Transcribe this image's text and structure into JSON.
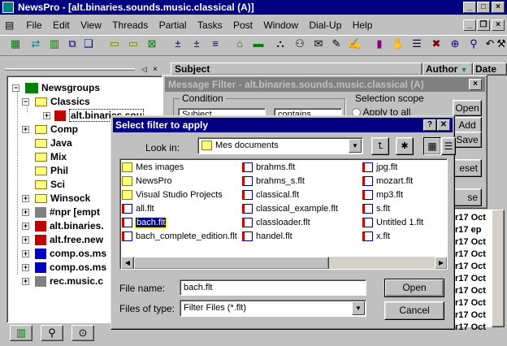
{
  "app": {
    "title": "NewsPro - [alt.binaries.sounds.music.classical (A)]",
    "menu": [
      "File",
      "Edit",
      "View",
      "Threads",
      "Partial",
      "Tasks",
      "Post",
      "Window",
      "Dial-Up",
      "Help"
    ]
  },
  "tree": {
    "items": [
      {
        "label": "Newsgroups"
      },
      {
        "label": "Classics"
      },
      {
        "label": "alt.binaries.sou"
      },
      {
        "label": "Comp"
      },
      {
        "label": "Java"
      },
      {
        "label": "Mix"
      },
      {
        "label": "Phil"
      },
      {
        "label": "Sci"
      },
      {
        "label": "Winsock"
      },
      {
        "label": "#npr  [empt"
      },
      {
        "label": "alt.binaries."
      },
      {
        "label": "alt.free.new"
      },
      {
        "label": "comp.os.ms"
      },
      {
        "label": "comp.os.ms"
      },
      {
        "label": "rec.music.c"
      }
    ]
  },
  "list_header": {
    "subject": "Subject",
    "author": "Author",
    "date": "Date"
  },
  "right_rows": [
    "r17  Oct",
    "r17  ep",
    "r17  Oct",
    "r17  Oct",
    "r17  Oct",
    "r17  Oct",
    "r17  Oct",
    "r17  Oct",
    "r17  Oct",
    "r17  Oct"
  ],
  "message_filter": {
    "title": "Message Filter - alt.binaries.sounds.music.classical (A)",
    "condition_label": "Condition",
    "subject_value": "Subject",
    "contains_value": "contains",
    "scope_label": "Selection scope",
    "apply_all": "Apply to all",
    "buttons": [
      "Open",
      "Add",
      "Save",
      "eset",
      "se"
    ]
  },
  "dialog": {
    "title": "Select filter to apply",
    "look_in_label": "Look in:",
    "look_in_value": "Mes documents",
    "files": [
      {
        "name": "Mes images",
        "type": "folder"
      },
      {
        "name": "NewsPro",
        "type": "folder"
      },
      {
        "name": "Visual Studio Projects",
        "type": "folder"
      },
      {
        "name": "all.flt",
        "type": "flt"
      },
      {
        "name": "bach.flt",
        "type": "flt",
        "selected": true
      },
      {
        "name": "bach_complete_edition.flt",
        "type": "flt"
      },
      {
        "name": "brahms.flt",
        "type": "flt"
      },
      {
        "name": "brahms_s.flt",
        "type": "flt"
      },
      {
        "name": "classical.flt",
        "type": "flt"
      },
      {
        "name": "classical_example.flt",
        "type": "flt"
      },
      {
        "name": "classloader.flt",
        "type": "flt"
      },
      {
        "name": "handel.flt",
        "type": "flt"
      },
      {
        "name": "jpg.flt",
        "type": "flt"
      },
      {
        "name": "mozart.flt",
        "type": "flt"
      },
      {
        "name": "mp3.flt",
        "type": "flt"
      },
      {
        "name": "s.flt",
        "type": "flt"
      },
      {
        "name": "Untitled 1.flt",
        "type": "flt"
      },
      {
        "name": "x.flt",
        "type": "flt"
      }
    ],
    "file_name_label": "File name:",
    "file_name_value": "bach.flt",
    "files_of_type_label": "Files of type:",
    "files_of_type_value": "Filter Files (*.flt)",
    "open_label": "Open",
    "cancel_label": "Cancel",
    "help_label": "?",
    "close_label": "✕"
  },
  "colors": {
    "titlebar": "#000080",
    "selection": "#000080",
    "face": "#c0c0c0"
  }
}
